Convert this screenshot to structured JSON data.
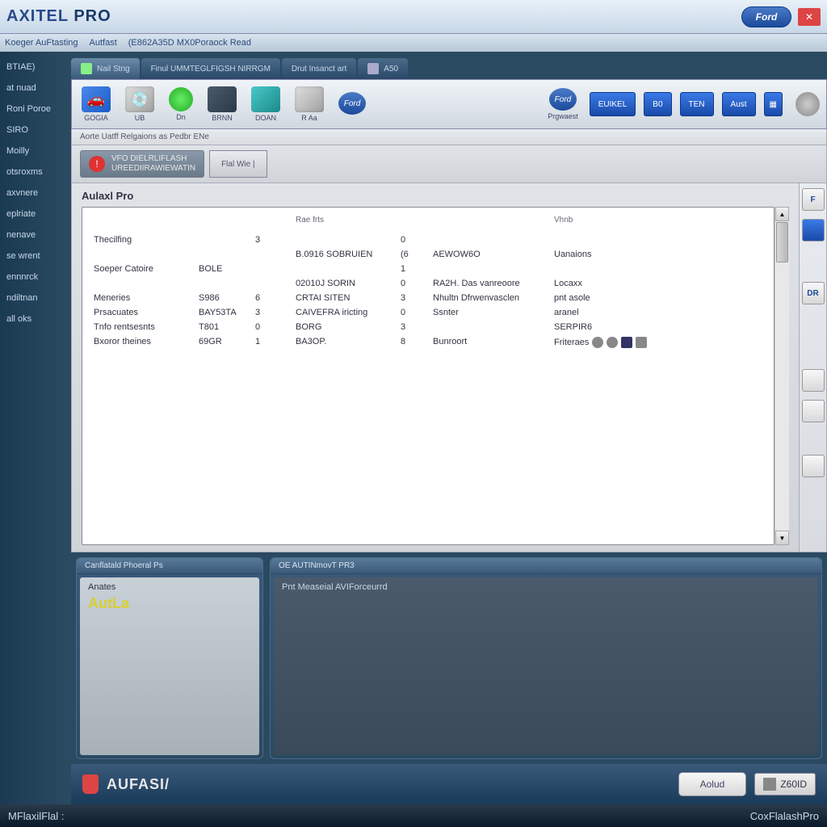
{
  "title": {
    "brand": "AXITEL",
    "suffix": "PRO"
  },
  "menu": {
    "item1": "Koeger AuFtasting",
    "item2": "Autfast",
    "item3": "(E862A35D MX0Poraock Read"
  },
  "sidebar": {
    "items": [
      {
        "label": "BTIAE)"
      },
      {
        "label": "at nuad"
      },
      {
        "label": "Roni Poroe"
      },
      {
        "label": "SIRO"
      },
      {
        "label": "Moilly"
      },
      {
        "label": "otsroxms"
      },
      {
        "label": "axvnere"
      },
      {
        "label": "eplriate"
      },
      {
        "label": "nenave"
      },
      {
        "label": "se wrent"
      },
      {
        "label": "ennnrck"
      },
      {
        "label": "ndiltnan"
      },
      {
        "label": "all oks"
      }
    ]
  },
  "tabs": {
    "items": [
      {
        "label": "Nail Stng"
      },
      {
        "label": "Finul UMMTEGLFIGSH NIRRGM"
      },
      {
        "label": "Drut Insanct art"
      },
      {
        "label": "A50"
      }
    ]
  },
  "toolbar": {
    "items": [
      {
        "label": "GOGIA"
      },
      {
        "label": "UB"
      },
      {
        "label": "Dn"
      },
      {
        "label": "BRNN"
      },
      {
        "label": "DOAN"
      },
      {
        "label": "R Aa"
      },
      {
        "label": ""
      }
    ],
    "right_label": "Prgwaest",
    "blue_buttons": [
      {
        "label": "EUIKEL"
      },
      {
        "label": "B0"
      },
      {
        "label": "TEN"
      },
      {
        "label": "Aust"
      },
      {
        "label": ""
      }
    ]
  },
  "subbar": {
    "text": "Aorte Uatff Relgaions as Pedbr ENe"
  },
  "alert": {
    "line1": "VFO DIELRLIFLASH",
    "line2": "UREEDIIRAWIEWATIN",
    "right": "Flal Wie"
  },
  "panel": {
    "title": "Aulaxl Pro",
    "headers": {
      "c1": "",
      "c2": "",
      "c3": "",
      "c4": "Rae frts",
      "c5": "",
      "c6": "",
      "c7": "Vhnb"
    },
    "rows": [
      {
        "c1": "Thecilfing",
        "c2": "",
        "c3": "3",
        "c4": "",
        "c5": "0",
        "c6": "",
        "c7": ""
      },
      {
        "c1": "",
        "c2": "",
        "c3": "",
        "c4": "B.0916 SOBRUIEN",
        "c5": "(6",
        "c6": "AEWOW6O",
        "c7": "Uanaions"
      },
      {
        "c1": "Soeper Catoire",
        "c2": "BOLE",
        "c3": "",
        "c4": "",
        "c5": "1",
        "c6": "",
        "c7": ""
      },
      {
        "c1": "",
        "c2": "",
        "c3": "",
        "c4": "02010J SORIN",
        "c5": "0",
        "c6": "RA2H. Das vanreoore",
        "c7": "Locaxx"
      },
      {
        "c1": "Meneries",
        "c2": "S986",
        "c3": "6",
        "c4": "CRTAI SITEN",
        "c5": "3",
        "c6": "Nhultn Dfrwenvasclen",
        "c7": "pnt asole"
      },
      {
        "c1": "Prsacuates",
        "c2": "BAY53TA",
        "c3": "3",
        "c4": "CAIVEFRA iricting",
        "c5": "0",
        "c6": "Ssnter",
        "c7": "aranel"
      },
      {
        "c1": "Tnfo rentsesnts",
        "c2": "T801",
        "c3": "0",
        "c4": "BORG",
        "c5": "3",
        "c6": "",
        "c7": "SERPIR6"
      },
      {
        "c1": "Bxoror theines",
        "c2": "69GR",
        "c3": "1",
        "c4": "BA3OP.",
        "c5": "8",
        "c6": "Bunroort",
        "c7": "Friteraes"
      }
    ]
  },
  "right_panel": {
    "items": [
      "F",
      "",
      "DR",
      "",
      "",
      ""
    ]
  },
  "bottom": {
    "left": {
      "title": "Canflatald Phoeral Ps",
      "line1": "Anates",
      "line2": "AutLa"
    },
    "right": {
      "title": "OE AUTINmovT PR3",
      "line1": "Pnt Measeial AVIForceurrd"
    }
  },
  "footer": {
    "logo": "AUFASI/",
    "button": "Aolud",
    "badge": "Z60ID"
  },
  "status": {
    "left": "MFlaxilFlal :",
    "right": "CoxFlalashPro"
  },
  "ford_label": "Ford"
}
